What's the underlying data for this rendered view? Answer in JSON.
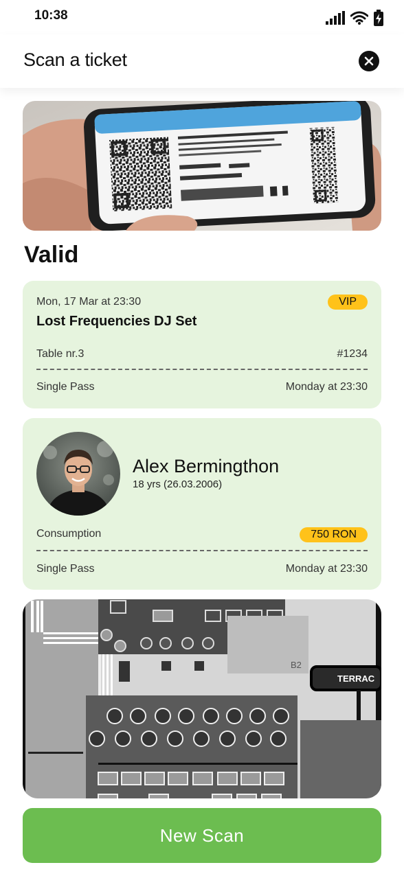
{
  "status_bar": {
    "time": "10:38"
  },
  "header": {
    "title": "Scan a ticket"
  },
  "result": {
    "status": "Valid"
  },
  "ticket": {
    "date": "Mon, 17 Mar at 23:30",
    "event": "Lost Frequencies DJ Set",
    "badge": "VIP",
    "table": "Table nr.3",
    "number": "#1234",
    "pass": "Single Pass",
    "when": "Monday at 23:30"
  },
  "attendee": {
    "name": "Alex Bermingthon",
    "age": "18 yrs (26.03.2006)",
    "consumption_label": "Consumption",
    "consumption_amount": "750 RON",
    "pass": "Single Pass",
    "when": "Monday at 23:30"
  },
  "map": {
    "section_label": "B2",
    "terrace_label": "TERRAC"
  },
  "actions": {
    "new_scan": "New Scan"
  },
  "colors": {
    "card_bg": "#e6f4de",
    "badge": "#ffc21a",
    "primary_button": "#6cbd50"
  }
}
